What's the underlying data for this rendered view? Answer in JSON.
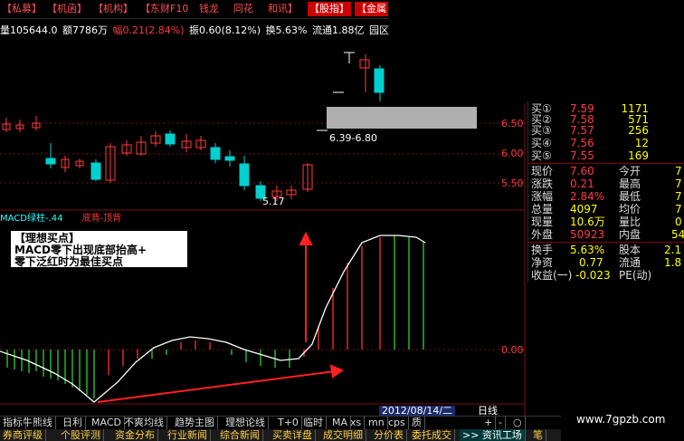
{
  "top_tabs": [
    {
      "label": "【私募】",
      "highlight": false
    },
    {
      "label": "【机函】",
      "highlight": false
    },
    {
      "label": "【机构】",
      "highlight": false
    },
    {
      "label": "【东财F10",
      "highlight": false
    },
    {
      "label": "钱龙",
      "highlight": false
    },
    {
      "label": "同花",
      "highlight": false
    },
    {
      "label": "和讯】",
      "highlight": false
    },
    {
      "label": "【股指】",
      "highlight": true
    },
    {
      "label": "【金属",
      "highlight": true
    }
  ],
  "info": {
    "volume": "量105644.0",
    "amount": "额7786万",
    "change": "幅0.21(2.84%)",
    "amplitude": "振0.60(8.12%)",
    "turnover": "换5.63%",
    "float": "流通1.88亿",
    "region": "园区"
  },
  "price_axis": [
    "6.50",
    "6.00",
    "5.50"
  ],
  "macd_axis": "0.00",
  "annotations": {
    "range": "6.39-6.80",
    "low": "5.17",
    "macd_label_a": "MACD绿柱-.44",
    "macd_label_b": "底背-顶背"
  },
  "quote": {
    "bids": [
      {
        "label": "买①",
        "price": "7.59",
        "vol": "1171"
      },
      {
        "label": "买②",
        "price": "7.58",
        "vol": "571"
      },
      {
        "label": "买③",
        "price": "7.57",
        "vol": "256"
      },
      {
        "label": "买④",
        "price": "7.56",
        "vol": "12"
      },
      {
        "label": "买⑤",
        "price": "7.55",
        "vol": "169"
      }
    ],
    "stats": [
      {
        "l1": "现价",
        "v1": "7.60",
        "l2": "今开",
        "v2": "7"
      },
      {
        "l1": "涨跌",
        "v1": "0.21",
        "l2": "最高",
        "v2": "7"
      },
      {
        "l1": "涨幅",
        "v1": "2.84%",
        "l2": "最低",
        "v2": "7"
      },
      {
        "l1": "总量",
        "v1": "4097",
        "l2": "均价",
        "v2": "7"
      },
      {
        "l1": "现量",
        "v1": "10.6万",
        "l2": "量比",
        "v2": "0"
      },
      {
        "l1": "外盘",
        "v1": "50923",
        "l2": "内盘",
        "v2": "54"
      }
    ],
    "extra": [
      {
        "l1": "换手",
        "v1": "5.63%",
        "l2": "股本",
        "v2": "2.1"
      },
      {
        "l1": "净资",
        "v1": "0.77",
        "l2": "流通",
        "v2": "1.8"
      },
      {
        "l1": "收益(一)",
        "v1": "-0.023",
        "l2": "PE(动)",
        "v2": ""
      }
    ]
  },
  "callout": {
    "title": "【理想买点】",
    "line1": "MACD零下出现底部抬高+",
    "line2": "零下泛红时为最佳买点"
  },
  "buttons": [
    "指标",
    "牛熊线",
    "日利",
    "MACD",
    "不爽均线",
    "趋势主图",
    "理想论线",
    "T+0",
    "临时",
    "MA",
    "xs",
    "mn",
    "cps",
    "质"
  ],
  "small_buttons": [
    "+",
    "-",
    "○"
  ],
  "date": "2012/08/14/二",
  "period": "日线",
  "tabs": [
    "券商评级",
    "个股评测",
    "资金分布",
    "行业新闻",
    "综合新闻",
    "买卖详盘",
    "成交明细",
    "分价表",
    "委托成交",
    ">> 资讯工场",
    "笔"
  ],
  "watermark": "www.7gpzb.com",
  "colors": {
    "up": "#ff3b3b",
    "down": "#00d0d0",
    "macd_up": "#ff3030",
    "macd_down": "#30d030"
  }
}
